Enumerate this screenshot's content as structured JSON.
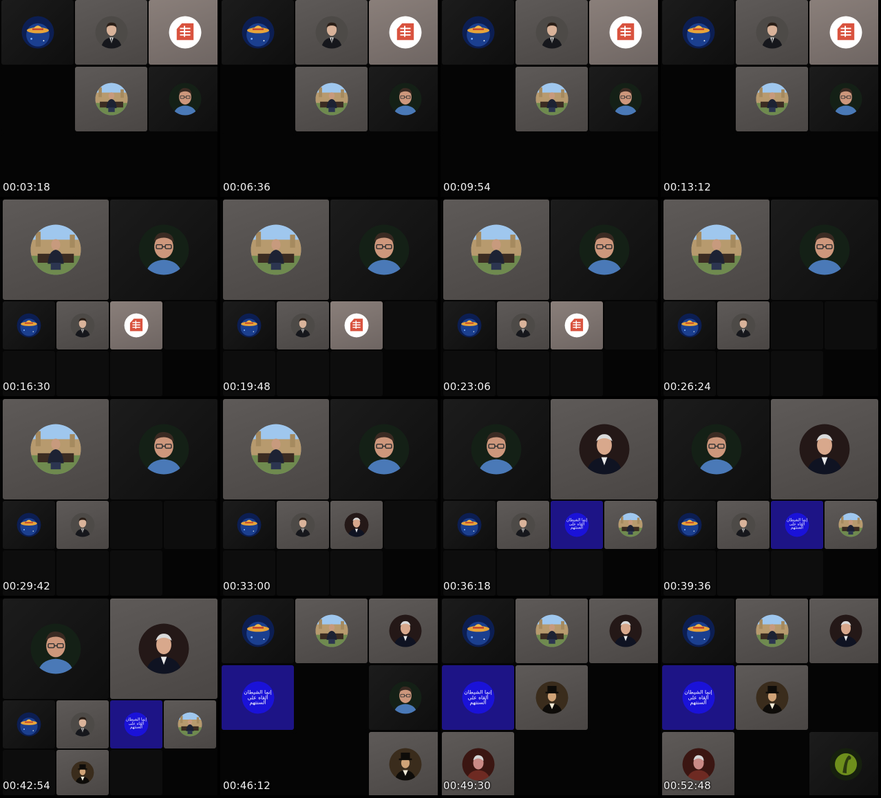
{
  "app": {
    "title": "",
    "colors": {
      "background": "#000000",
      "timestamp": "#f2f2f2",
      "blue_tile": "#1d1486",
      "logo_red": "#d9533f"
    }
  },
  "avatar_types": {
    "hat": {
      "name": "hat-planet-avatar"
    },
    "suit_man": {
      "name": "young-man-suit-avatar"
    },
    "logo": {
      "name": "red-logo-avatar"
    },
    "street": {
      "name": "man-city-street-avatar"
    },
    "glasses": {
      "name": "man-glasses-avatar"
    },
    "coach": {
      "name": "coach-suit-avatar"
    },
    "arabic": {
      "name": "arabic-text-avatar",
      "text": "إنما الشيطان ألقاه على ألسنتهم"
    },
    "vintage": {
      "name": "vintage-gentleman-avatar"
    },
    "redman": {
      "name": "man-red-avatar"
    },
    "green": {
      "name": "green-figure-avatar"
    }
  },
  "thumbnails": [
    {
      "time": "00:03:18",
      "layout": "gridA",
      "tiles": [
        [
          "dark",
          "hat"
        ],
        [
          "mid",
          "suit_man"
        ],
        [
          "light",
          "logo"
        ],
        [
          "black",
          null
        ],
        [
          "mid",
          "street"
        ],
        [
          "dark",
          "glasses"
        ],
        [
          "black",
          null
        ],
        [
          "black",
          null
        ],
        [
          "black",
          null
        ]
      ]
    },
    {
      "time": "00:06:36",
      "layout": "gridA",
      "tiles": [
        [
          "dark",
          "hat"
        ],
        [
          "mid",
          "suit_man"
        ],
        [
          "light",
          "logo"
        ],
        [
          "black",
          null
        ],
        [
          "mid",
          "street"
        ],
        [
          "dark",
          "glasses"
        ],
        [
          "black",
          null
        ],
        [
          "black",
          null
        ],
        [
          "black",
          null
        ]
      ]
    },
    {
      "time": "00:09:54",
      "layout": "gridA",
      "tiles": [
        [
          "dark",
          "hat"
        ],
        [
          "mid",
          "suit_man"
        ],
        [
          "light",
          "logo"
        ],
        [
          "black",
          null
        ],
        [
          "mid",
          "street"
        ],
        [
          "dark",
          "glasses"
        ],
        [
          "black",
          null
        ],
        [
          "black",
          null
        ],
        [
          "black",
          null
        ]
      ]
    },
    {
      "time": "00:13:12",
      "layout": "gridA",
      "tiles": [
        [
          "dark",
          "hat"
        ],
        [
          "mid",
          "suit_man"
        ],
        [
          "light",
          "logo"
        ],
        [
          "black",
          null
        ],
        [
          "mid",
          "street"
        ],
        [
          "dark",
          "glasses"
        ],
        [
          "black",
          null
        ],
        [
          "black",
          null
        ],
        [
          "black",
          null
        ]
      ]
    },
    {
      "time": "00:16:30",
      "layout": "spot",
      "big": [
        [
          "mid",
          "street"
        ],
        [
          "dark",
          "glasses"
        ]
      ],
      "small": [
        [
          "dark",
          "hat"
        ],
        [
          "mid",
          "suit_man"
        ],
        [
          "light",
          "logo"
        ],
        [
          "empty",
          null
        ]
      ]
    },
    {
      "time": "00:19:48",
      "layout": "spot",
      "big": [
        [
          "mid",
          "street"
        ],
        [
          "dark",
          "glasses"
        ]
      ],
      "small": [
        [
          "dark",
          "hat"
        ],
        [
          "mid",
          "suit_man"
        ],
        [
          "light",
          "logo"
        ],
        [
          "empty",
          null
        ]
      ]
    },
    {
      "time": "00:23:06",
      "layout": "spot",
      "big": [
        [
          "mid",
          "street"
        ],
        [
          "dark",
          "glasses"
        ]
      ],
      "small": [
        [
          "dark",
          "hat"
        ],
        [
          "mid",
          "suit_man"
        ],
        [
          "light",
          "logo"
        ],
        [
          "empty",
          null
        ]
      ]
    },
    {
      "time": "00:26:24",
      "layout": "spot",
      "big": [
        [
          "mid",
          "street"
        ],
        [
          "dark",
          "glasses"
        ]
      ],
      "small": [
        [
          "dark",
          "hat"
        ],
        [
          "mid",
          "suit_man"
        ],
        [
          "empty",
          null
        ],
        [
          "empty",
          null
        ]
      ]
    },
    {
      "time": "00:29:42",
      "layout": "spot",
      "big": [
        [
          "mid",
          "street"
        ],
        [
          "dark",
          "glasses"
        ]
      ],
      "small": [
        [
          "dark",
          "hat"
        ],
        [
          "mid",
          "suit_man"
        ],
        [
          "empty",
          null
        ],
        [
          "empty",
          null
        ]
      ]
    },
    {
      "time": "00:33:00",
      "layout": "spot",
      "big": [
        [
          "mid",
          "street"
        ],
        [
          "dark",
          "glasses"
        ]
      ],
      "small": [
        [
          "dark",
          "hat"
        ],
        [
          "mid",
          "suit_man"
        ],
        [
          "mid",
          "coach"
        ],
        [
          "empty",
          null
        ]
      ]
    },
    {
      "time": "00:36:18",
      "layout": "spot",
      "big": [
        [
          "dark",
          "glasses"
        ],
        [
          "mid",
          "coach"
        ]
      ],
      "small": [
        [
          "dark",
          "hat"
        ],
        [
          "mid",
          "suit_man"
        ],
        [
          "blue",
          "arabic"
        ],
        [
          "mid",
          "street"
        ]
      ]
    },
    {
      "time": "00:39:36",
      "layout": "spot",
      "big": [
        [
          "dark",
          "glasses"
        ],
        [
          "mid",
          "coach"
        ]
      ],
      "small": [
        [
          "dark",
          "hat"
        ],
        [
          "mid",
          "suit_man"
        ],
        [
          "blue",
          "arabic"
        ],
        [
          "mid",
          "street"
        ]
      ]
    },
    {
      "time": "00:42:54",
      "layout": "spot",
      "big": [
        [
          "dark",
          "glasses"
        ],
        [
          "mid",
          "coach"
        ]
      ],
      "small": [
        [
          "dark",
          "hat"
        ],
        [
          "mid",
          "suit_man"
        ],
        [
          "blue",
          "arabic"
        ],
        [
          "mid",
          "street"
        ]
      ],
      "extra": [
        [
          "empty",
          null
        ],
        [
          "mid",
          "vintage"
        ],
        [
          "empty",
          null
        ]
      ]
    },
    {
      "time": "00:46:12",
      "layout": "gridA",
      "tiles": [
        [
          "dark",
          "hat"
        ],
        [
          "mid",
          "street"
        ],
        [
          "mid",
          "coach"
        ],
        [
          "blue",
          "arabic"
        ],
        [
          "black",
          null
        ],
        [
          "dark",
          "glasses"
        ],
        [
          "black",
          null
        ],
        [
          "black",
          null
        ],
        [
          "mid",
          "vintage"
        ]
      ]
    },
    {
      "time": "00:49:30",
      "layout": "gridA",
      "tiles": [
        [
          "dark",
          "hat"
        ],
        [
          "mid",
          "street"
        ],
        [
          "mid",
          "coach"
        ],
        [
          "blue",
          "arabic"
        ],
        [
          "mid",
          "vintage"
        ],
        [
          "black",
          null
        ],
        [
          "mid",
          "redman"
        ],
        [
          "black",
          null
        ],
        [
          "black",
          null
        ]
      ]
    },
    {
      "time": "00:52:48",
      "layout": "gridA",
      "tiles": [
        [
          "dark",
          "hat"
        ],
        [
          "mid",
          "street"
        ],
        [
          "mid",
          "coach"
        ],
        [
          "blue",
          "arabic"
        ],
        [
          "mid",
          "vintage"
        ],
        [
          "black",
          null
        ],
        [
          "mid",
          "redman"
        ],
        [
          "black",
          null
        ],
        [
          "dark",
          "green"
        ]
      ]
    }
  ]
}
